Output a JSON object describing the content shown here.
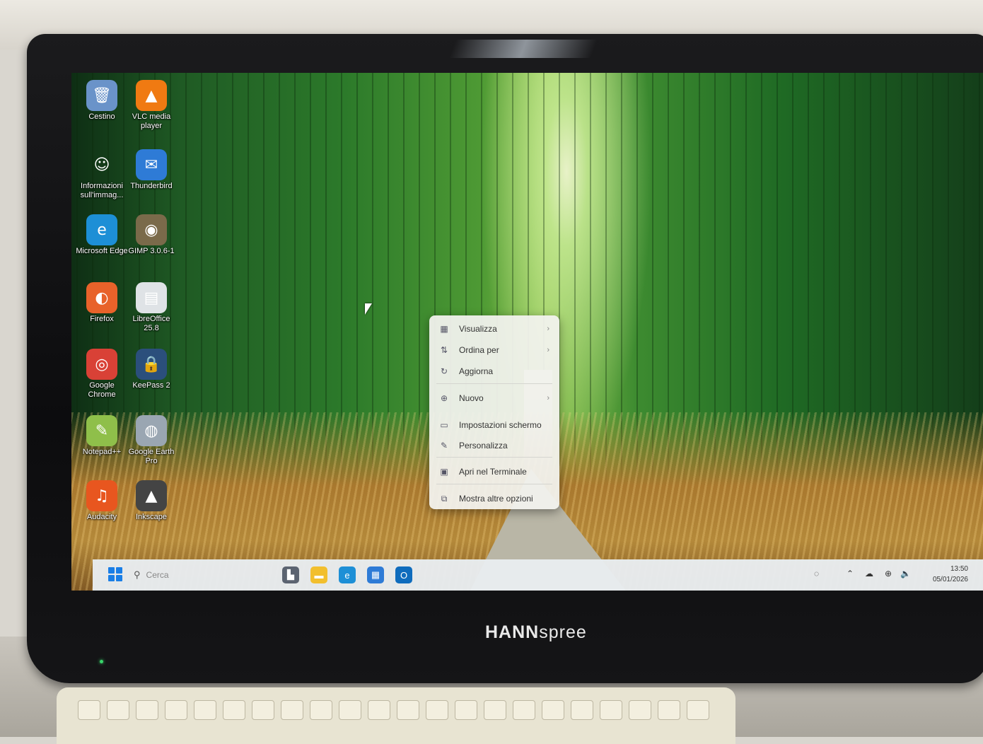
{
  "brand": {
    "bold": "HANN",
    "rest": "spree"
  },
  "desktop_icons": [
    {
      "label": "Cestino",
      "icon": "recycle-bin-icon",
      "color": "#6a93c9",
      "glyph": "🗑"
    },
    {
      "label": "VLC media player",
      "icon": "vlc-icon",
      "color": "#f07a12",
      "glyph": "▲"
    },
    {
      "label": "Informazioni sull'immag...",
      "icon": "info-icon",
      "color": "transparent",
      "glyph": "☺"
    },
    {
      "label": "Thunderbird",
      "icon": "thunderbird-icon",
      "color": "#2e7bd6",
      "glyph": "✉"
    },
    {
      "label": "Microsoft Edge",
      "icon": "edge-icon",
      "color": "#1d8fd6",
      "glyph": "e"
    },
    {
      "label": "GIMP 3.0.6-1",
      "icon": "gimp-icon",
      "color": "#7a6a4a",
      "glyph": "◉"
    },
    {
      "label": "Firefox",
      "icon": "firefox-icon",
      "color": "#e8622a",
      "glyph": "◐"
    },
    {
      "label": "LibreOffice 25.8",
      "icon": "libreoffice-icon",
      "color": "#dfe3e6",
      "glyph": "▤"
    },
    {
      "label": "Google Chrome",
      "icon": "chrome-icon",
      "color": "#d94136",
      "glyph": "◎"
    },
    {
      "label": "KeePass 2",
      "icon": "keepass-icon",
      "color": "#2b4f7c",
      "glyph": "🔒"
    },
    {
      "label": "Notepad++",
      "icon": "notepadpp-icon",
      "color": "#8fbf4a",
      "glyph": "✎"
    },
    {
      "label": "Google Earth Pro",
      "icon": "google-earth-icon",
      "color": "#9aa6b2",
      "glyph": "◍"
    },
    {
      "label": "Audacity",
      "icon": "audacity-icon",
      "color": "#e8561f",
      "glyph": "♫"
    },
    {
      "label": "Inkscape",
      "icon": "inkscape-icon",
      "color": "#444",
      "glyph": "▲"
    }
  ],
  "context_menu": {
    "items": [
      {
        "label": "Visualizza",
        "icon": "grid-icon",
        "glyph": "▦",
        "has_submenu": true
      },
      {
        "label": "Ordina per",
        "icon": "sort-icon",
        "glyph": "⇅",
        "has_submenu": true
      },
      {
        "label": "Aggiorna",
        "icon": "refresh-icon",
        "glyph": "↻",
        "has_submenu": false
      },
      {
        "label": "Nuovo",
        "icon": "new-icon",
        "glyph": "⊕",
        "has_submenu": true
      },
      {
        "label": "Impostazioni schermo",
        "icon": "display-settings-icon",
        "glyph": "▭",
        "has_submenu": false
      },
      {
        "label": "Personalizza",
        "icon": "personalize-icon",
        "glyph": "✎",
        "has_submenu": false
      },
      {
        "label": "Apri nel Terminale",
        "icon": "terminal-icon",
        "glyph": "▣",
        "has_submenu": false
      },
      {
        "label": "Mostra altre opzioni",
        "icon": "more-options-icon",
        "glyph": "⧉",
        "has_submenu": false
      }
    ],
    "chevron": "›"
  },
  "taskbar": {
    "search_placeholder": "Cerca",
    "search_glyph": "⚲",
    "apps": [
      {
        "name": "taskbar-cursor-app",
        "icon": "taskview-icon",
        "color": "#5b6370",
        "glyph": "▙"
      },
      {
        "name": "taskbar-file-explorer",
        "icon": "folder-icon",
        "color": "#f2bf2e",
        "glyph": "▬"
      },
      {
        "name": "taskbar-edge",
        "icon": "edge-icon",
        "color": "#1d8fd6",
        "glyph": "e"
      },
      {
        "name": "taskbar-store",
        "icon": "store-icon",
        "color": "#2e7bd6",
        "glyph": "▦"
      },
      {
        "name": "taskbar-outlook",
        "icon": "outlook-icon",
        "color": "#0f6cbd",
        "glyph": "O"
      }
    ],
    "tray": {
      "chevron": "⌃",
      "network": "☁",
      "globe": "⊕",
      "volume": "🔈"
    },
    "time": "13:50",
    "date": "05/01/2026"
  }
}
